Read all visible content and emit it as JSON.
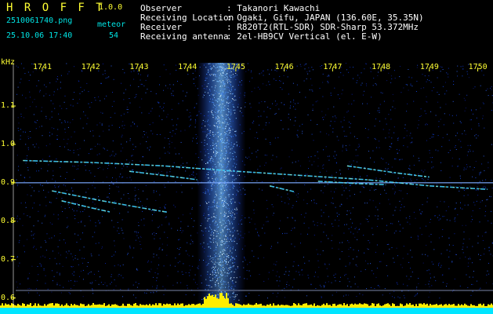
{
  "header": {
    "app_title": "H R O F F T",
    "version": "1.0.0",
    "filename": "2510061740.png",
    "datetime": "25.10.06 17:40",
    "meteor_label": "meteor",
    "meteor_count": "54"
  },
  "info": {
    "observer_label": "Observer",
    "observer_value": ": Takanori Kawachi",
    "location_label": "Receiving Location",
    "location_value": ": Ogaki, Gifu, JAPAN (136.60E, 35.35N)",
    "receiver_label": "Receiver",
    "receiver_value": ": R820T2(RTL-SDR) SDR-Sharp 53.372MHz",
    "antenna_label": "Receiving antenna",
    "antenna_value": ": 2el-HB9CV Vertical (el. E-W)"
  },
  "colors": {
    "background": "#000000",
    "noise_blue": "#0a1a8c",
    "signal_cyan": "#40d0ff",
    "header_yellow": "#ffff33",
    "header_cyan": "#00e5e5",
    "baseline_yellow": "#ffee00",
    "baseline_cyan": "#00e5ff"
  },
  "chart_data": {
    "type": "heatmap",
    "ylabel": "kHz",
    "x_ticks": [
      "1741",
      "1742",
      "1743",
      "1744",
      "1745",
      "1746",
      "1747",
      "1748",
      "1749",
      "1750"
    ],
    "x_tick_values": [
      1741,
      1742,
      1743,
      1744,
      1745,
      1746,
      1747,
      1748,
      1749,
      1750
    ],
    "xlim": [
      1740.45,
      1750.25
    ],
    "y_ticks": [
      "1.1",
      "1.0",
      "0.9",
      "0.8",
      "0.7",
      "0.6"
    ],
    "y_tick_values": [
      1.1,
      1.0,
      0.9,
      0.8,
      0.7,
      0.6
    ],
    "ylim": [
      0.593,
      1.188
    ],
    "carrier_khz": 0.9,
    "interference_band_minutes": [
      1744.2,
      1745.2
    ],
    "meteor_traces": [
      {
        "x": [
          1740.6,
          1742.0,
          1743.5,
          1744.9,
          1746.0,
          1747.7,
          1749.0,
          1750.2
        ],
        "y": [
          0.958,
          0.953,
          0.944,
          0.931,
          0.922,
          0.908,
          0.892,
          0.883
        ]
      },
      {
        "x": [
          1741.2,
          1742.2,
          1743.0,
          1743.6
        ],
        "y": [
          0.879,
          0.854,
          0.836,
          0.823
        ]
      },
      {
        "x": [
          1741.4,
          1742.0,
          1742.4
        ],
        "y": [
          0.853,
          0.835,
          0.824
        ]
      },
      {
        "x": [
          1742.8,
          1743.6,
          1744.2
        ],
        "y": [
          0.93,
          0.918,
          0.908
        ]
      },
      {
        "x": [
          1746.7,
          1747.5,
          1748.1
        ],
        "y": [
          0.904,
          0.898,
          0.895
        ]
      },
      {
        "x": [
          1745.7,
          1746.2
        ],
        "y": [
          0.892,
          0.877
        ]
      },
      {
        "x": [
          1747.3,
          1748.3,
          1749.0
        ],
        "y": [
          0.944,
          0.926,
          0.915
        ]
      }
    ]
  }
}
